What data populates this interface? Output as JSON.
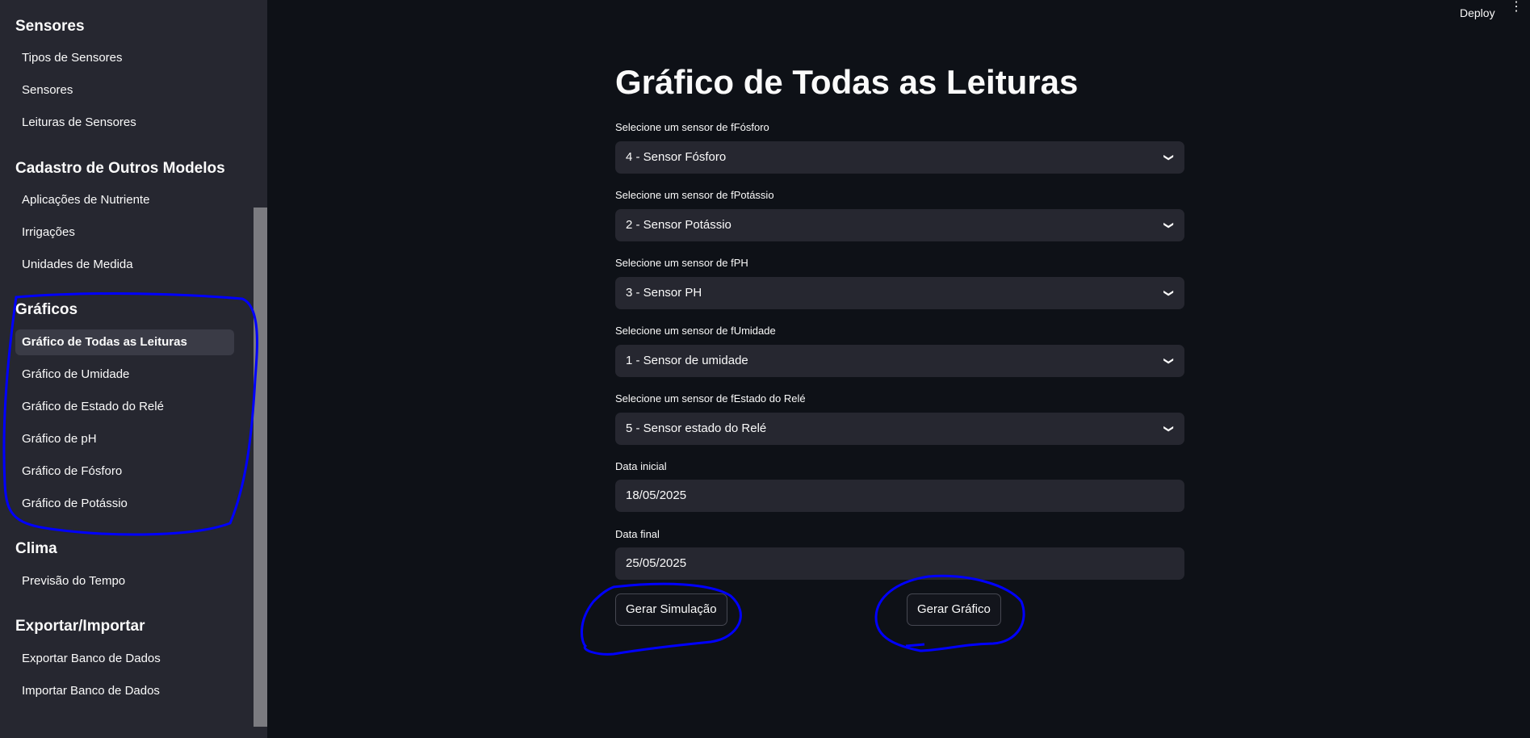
{
  "sidebar": {
    "sections": [
      {
        "title": "Sensores",
        "items": [
          "Tipos de Sensores",
          "Sensores",
          "Leituras de Sensores"
        ]
      },
      {
        "title": "Cadastro de Outros Modelos",
        "items": [
          "Aplicações de Nutriente",
          "Irrigações",
          "Unidades de Medida"
        ]
      },
      {
        "title": "Gráficos",
        "items": [
          "Gráfico de Todas as Leituras",
          "Gráfico de Umidade",
          "Gráfico de Estado do Relé",
          "Gráfico de pH",
          "Gráfico de Fósforo",
          "Gráfico de Potássio"
        ]
      },
      {
        "title": "Clima",
        "items": [
          "Previsão do Tempo"
        ]
      },
      {
        "title": "Exportar/Importar",
        "items": [
          "Exportar Banco de Dados",
          "Importar Banco de Dados"
        ]
      }
    ],
    "active_item": "Gráfico de Todas as Leituras"
  },
  "topbar": {
    "deploy": "Deploy",
    "menu_icon": "⋮"
  },
  "main": {
    "title": "Gráfico de Todas as Leituras",
    "selects": [
      {
        "label": "Selecione um sensor de fFósforo",
        "value": "4 - Sensor Fósforo"
      },
      {
        "label": "Selecione um sensor de fPotássio",
        "value": "2 - Sensor Potássio"
      },
      {
        "label": "Selecione um sensor de fPH",
        "value": "3 - Sensor PH"
      },
      {
        "label": "Selecione um sensor de fUmidade",
        "value": "1 - Sensor de umidade"
      },
      {
        "label": "Selecione um sensor de fEstado do Relé",
        "value": "5 - Sensor estado do Relé"
      }
    ],
    "date_start": {
      "label": "Data inicial",
      "value": "18/05/2025"
    },
    "date_end": {
      "label": "Data final",
      "value": "25/05/2025"
    },
    "btn_simulate": "Gerar Simulação",
    "btn_chart": "Gerar Gráfico"
  },
  "colors": {
    "annotation": "#0000ff",
    "sidebar_bg": "#262730",
    "main_bg": "#0e1117"
  }
}
